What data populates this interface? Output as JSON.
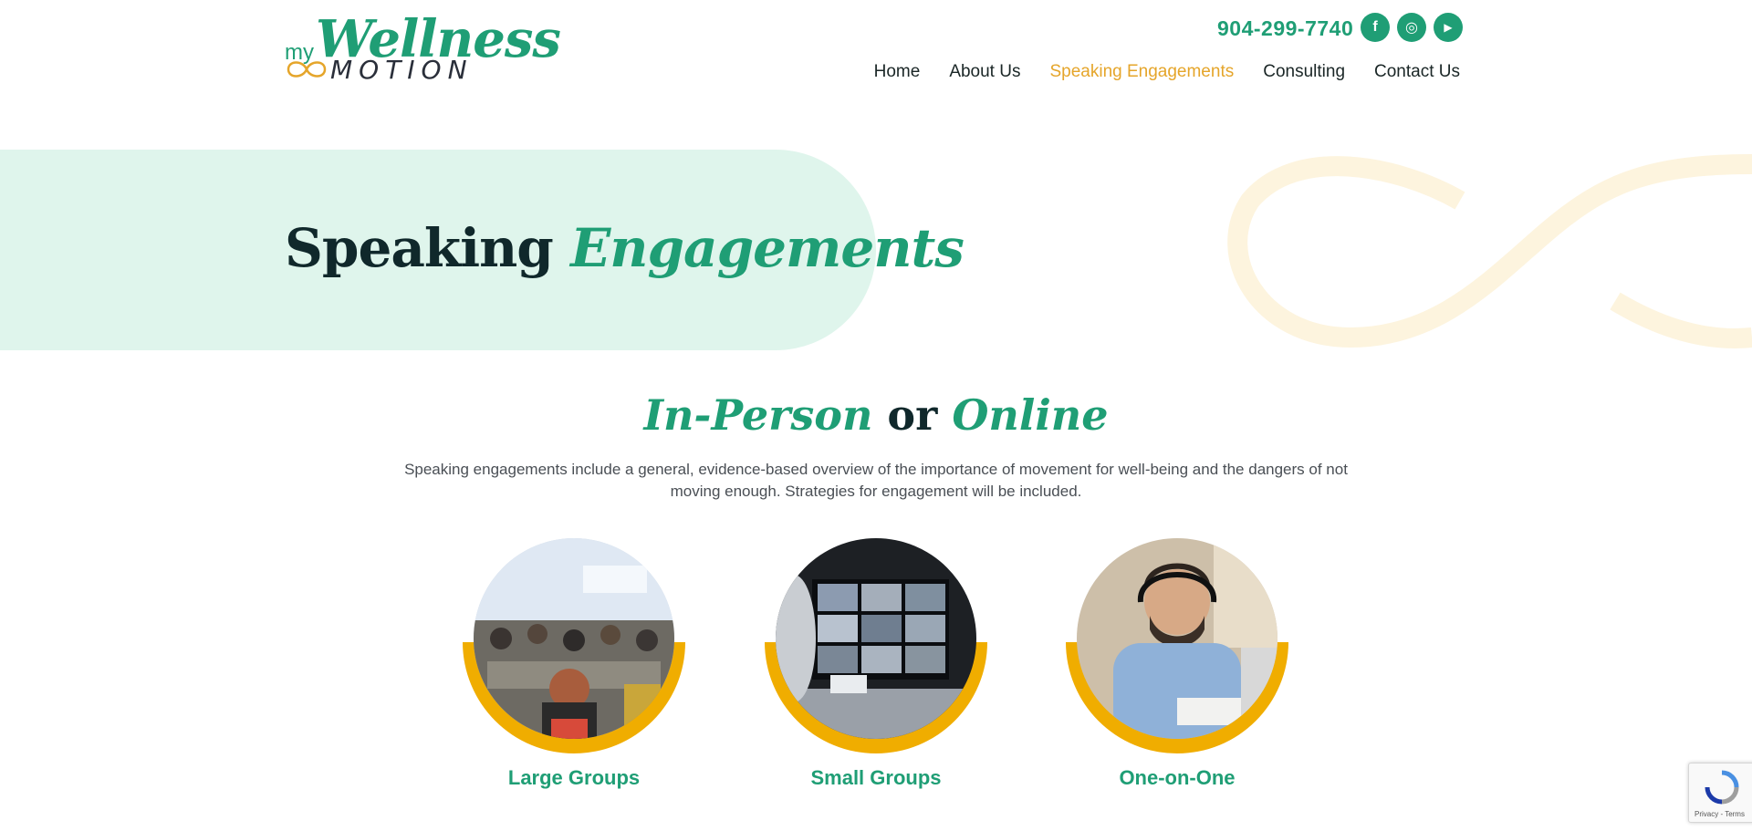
{
  "logo": {
    "my": "my",
    "wellness": "Wellness",
    "motion": "MOTION"
  },
  "header": {
    "phone": "904-299-7740",
    "social": [
      {
        "name": "facebook-icon",
        "glyph": "f"
      },
      {
        "name": "instagram-icon",
        "glyph": "◎"
      },
      {
        "name": "youtube-icon",
        "glyph": "▶"
      }
    ],
    "nav": [
      {
        "label": "Home"
      },
      {
        "label": "About Us"
      },
      {
        "label": "Speaking Engagements",
        "active": true
      },
      {
        "label": "Consulting"
      },
      {
        "label": "Contact Us"
      }
    ]
  },
  "hero": {
    "title_plain": "Speaking",
    "title_accent": "Engagements"
  },
  "intro": {
    "heading_part1": "In-Person",
    "heading_mid": "or",
    "heading_part2": "Online",
    "text": "Speaking engagements include a general, evidence-based overview of the importance of movement for well-being and the dangers of not moving enough. Strategies for engagement will be included."
  },
  "cards": [
    {
      "label": "Large Groups"
    },
    {
      "label": "Small Groups"
    },
    {
      "label": "One-on-One"
    }
  ],
  "recaptcha": {
    "terms": "Privacy - Terms"
  },
  "colors": {
    "brand_green": "#1f9e75",
    "accent_orange": "#e5a52a",
    "ring_yellow": "#f0ad00",
    "hero_bg": "#dff5ec"
  }
}
